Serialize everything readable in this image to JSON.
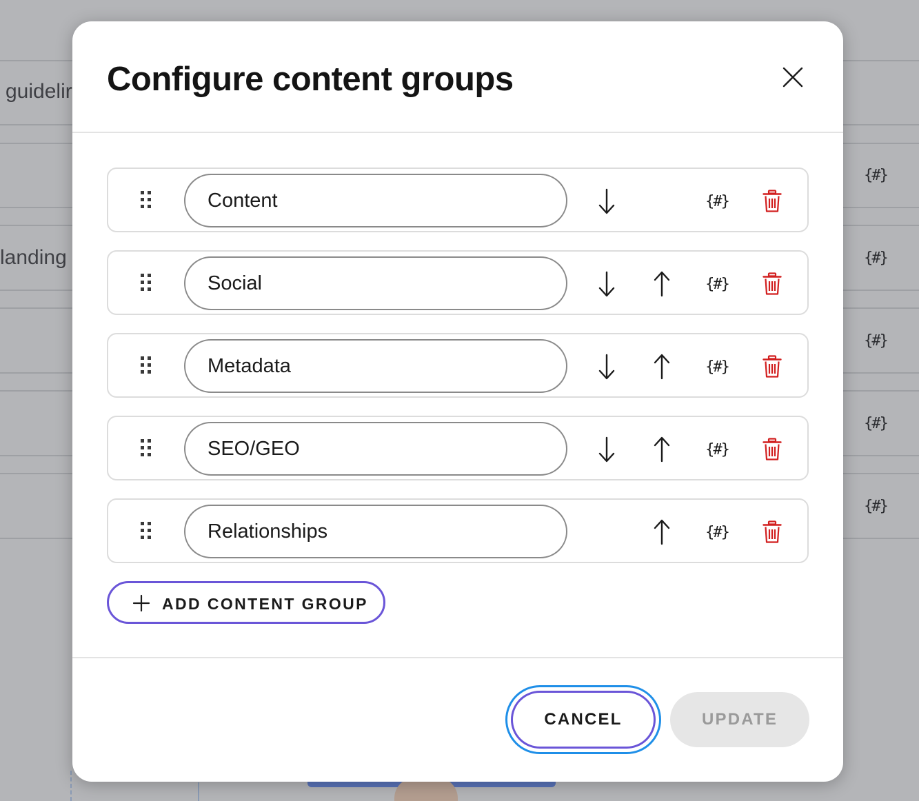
{
  "background": {
    "snippets": [
      "guidelir",
      "landing"
    ],
    "var_icon_glyph": "{#}"
  },
  "modal": {
    "title": "Configure content groups",
    "close_icon": "close-icon"
  },
  "groups": [
    {
      "name": "Content",
      "can_move_down": true,
      "can_move_up": false
    },
    {
      "name": "Social",
      "can_move_down": true,
      "can_move_up": true
    },
    {
      "name": "Metadata",
      "can_move_down": true,
      "can_move_up": true
    },
    {
      "name": "SEO/GEO",
      "can_move_down": true,
      "can_move_up": true
    },
    {
      "name": "Relationships",
      "can_move_down": false,
      "can_move_up": true
    }
  ],
  "row_icons": {
    "drag": "drag-handle-icon",
    "down": "arrow-down-icon",
    "up": "arrow-up-icon",
    "variable": "variable-icon",
    "variable_glyph": "{#}",
    "delete": "trash-icon"
  },
  "actions": {
    "add_label": "ADD CONTENT GROUP",
    "cancel_label": "CANCEL",
    "update_label": "UPDATE",
    "update_enabled": false
  },
  "colors": {
    "accent": "#6a55d8",
    "focus_ring": "#1f8fe8",
    "delete": "#d21f1f",
    "disabled_bg": "#e6e6e6",
    "disabled_text": "#9a9a9a"
  }
}
